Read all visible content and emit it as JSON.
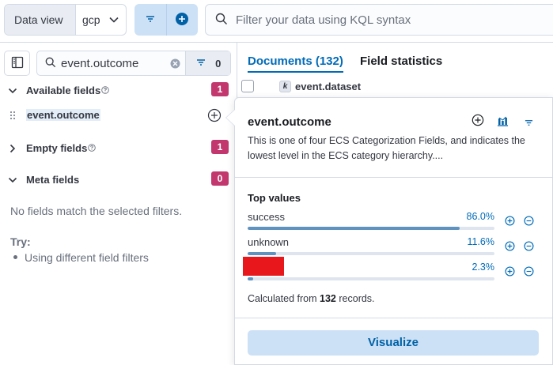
{
  "topbar": {
    "data_view_label": "Data view",
    "data_view_value": "gcp",
    "kql_placeholder": "Filter your data using KQL syntax"
  },
  "sidebar": {
    "search_value": "event.outcome",
    "filter_count": "0",
    "sections": {
      "available": {
        "label": "Available fields",
        "count": "1"
      },
      "empty": {
        "label": "Empty fields",
        "count": "1"
      },
      "meta": {
        "label": "Meta fields",
        "count": "0"
      }
    },
    "selected_field": "event.outcome",
    "no_match": "No fields match the selected filters.",
    "try_label": "Try:",
    "try_items": [
      "Using different field filters"
    ]
  },
  "main": {
    "tabs": [
      {
        "label": "Documents (132)",
        "active": true
      },
      {
        "label": "Field statistics",
        "active": false
      }
    ],
    "doc_field_token": "k",
    "doc_field": "event.dataset"
  },
  "popover": {
    "title": "event.outcome",
    "description": "This is one of four ECS Categorization Fields, and indicates the lowest level in the ECS category hierarchy....",
    "top_values_title": "Top values",
    "top_values": [
      {
        "label": "success",
        "percent": "86.0%",
        "fraction": 0.86
      },
      {
        "label": "unknown",
        "percent": "11.6%",
        "fraction": 0.116
      },
      {
        "label": "",
        "percent": "2.3%",
        "fraction": 0.023,
        "redacted": true
      }
    ],
    "calc_prefix": "Calculated from",
    "calc_count": "132",
    "calc_suffix": "records.",
    "visualize_label": "Visualize"
  },
  "colors": {
    "accent": "#006bb8",
    "badge": "#c2376e",
    "bar_fill": "#6092c0",
    "redaction": "#e8171c"
  },
  "icons": [
    "chevron-down-icon",
    "filter-icon",
    "plus-circle-icon",
    "search-icon",
    "sidebar-toggle-icon",
    "clear-icon",
    "help-icon",
    "drag-handle-icon",
    "chevron-right-icon",
    "visualize-icon",
    "minus-circle-icon"
  ]
}
